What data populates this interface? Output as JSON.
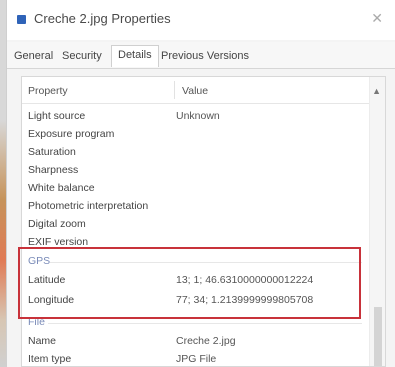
{
  "window": {
    "title": "Creche 2.jpg Properties"
  },
  "tabs": [
    {
      "label": "General"
    },
    {
      "label": "Security"
    },
    {
      "label": "Details"
    },
    {
      "label": "Previous Versions"
    }
  ],
  "table": {
    "col_property": "Property",
    "col_value": "Value"
  },
  "rows": [
    {
      "key": "Light source",
      "value": "Unknown"
    },
    {
      "key": "Exposure program",
      "value": ""
    },
    {
      "key": "Saturation",
      "value": ""
    },
    {
      "key": "Sharpness",
      "value": ""
    },
    {
      "key": "White balance",
      "value": ""
    },
    {
      "key": "Photometric interpretation",
      "value": ""
    },
    {
      "key": "Digital zoom",
      "value": ""
    },
    {
      "key": "EXIF version",
      "value": ""
    }
  ],
  "gps": {
    "section": "GPS",
    "latitude_label": "Latitude",
    "latitude_value": "13; 1; 46.6310000000012224",
    "longitude_label": "Longitude",
    "longitude_value": "77; 34; 1.2139999999805708"
  },
  "file": {
    "section": "File",
    "name_label": "Name",
    "name_value": "Creche 2.jpg",
    "type_label": "Item type",
    "type_value": "JPG File"
  },
  "colors": {
    "highlight": "#c8323a",
    "section_text": "#7a8bb8",
    "title_icon": "#2f63b8"
  }
}
